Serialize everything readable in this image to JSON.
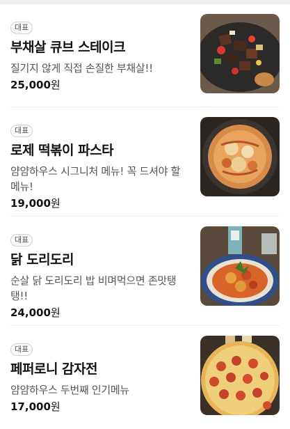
{
  "menu": [
    {
      "badge": "대표",
      "name": "부채살 큐브 스테이크",
      "description": "질기지 않게 직접 손질한 부채살!!",
      "price": "25,000",
      "currency": "원",
      "image": "steak-photo"
    },
    {
      "badge": "대표",
      "name": "로제 떡볶이 파스타",
      "description": "얌얌하우스 시그니처 메뉴! 꼭 드셔야 할 메뉴!",
      "price": "19,000",
      "currency": "원",
      "image": "rose-pasta-photo"
    },
    {
      "badge": "대표",
      "name": "닭 도리도리",
      "description": "순살 닭 도리도리 밥 비며먹으면 존맛탱탱!!",
      "price": "24,000",
      "currency": "원",
      "image": "chicken-stew-photo"
    },
    {
      "badge": "대표",
      "name": "페퍼로니 감자전",
      "description": "얌얌하우스 두번째 인기메뉴",
      "price": "17,000",
      "currency": "원",
      "image": "pepperoni-potato-pancake-photo"
    }
  ]
}
